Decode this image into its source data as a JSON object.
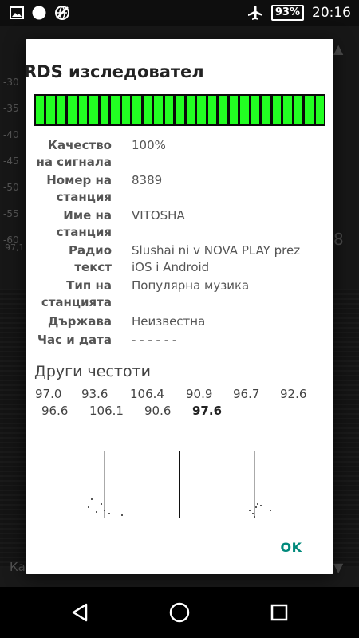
{
  "status_bar": {
    "icons_left": [
      "image-icon",
      "circle-icon",
      "no-network-icon"
    ],
    "icons_right": [
      "airplane-mode-icon"
    ],
    "battery": "93%",
    "time": "20:16"
  },
  "background": {
    "scale": [
      "-30",
      "-35",
      "-40",
      "-45",
      "-50",
      "-55",
      "-60"
    ],
    "freq_label": "97,1",
    "bottom_label": "Ка",
    "right_number": "8"
  },
  "dialog": {
    "title": "RDS изследовател",
    "signal_segments": 27,
    "signal_level_percent": 100,
    "signal_color": "#22ff22",
    "fields": [
      {
        "label_lines": [
          "Качество",
          "на сигнала"
        ],
        "value": "100%"
      },
      {
        "label_lines": [
          "Номер на",
          "станция"
        ],
        "value": "8389"
      },
      {
        "label_lines": [
          "Име на",
          "станция"
        ],
        "value": "VITOSHA"
      },
      {
        "label_lines": [
          "Радио",
          "текст"
        ],
        "value": "Slushai ni v NOVA PLAY prez iOS i Android"
      },
      {
        "label_lines": [
          "Тип на",
          "станцията"
        ],
        "value": "Популярна музика"
      },
      {
        "label_lines": [
          "Държава"
        ],
        "value": "Неизвестна"
      },
      {
        "label_lines": [
          "Час и дата"
        ],
        "value": "- - - - - -"
      }
    ],
    "other_frequencies_title": "Други честоти",
    "frequencies_row1": [
      "97.0",
      "93.6",
      "106.4",
      "90.9",
      "96.7",
      "92.6"
    ],
    "frequencies_row2": [
      "96.6",
      "106.1",
      "90.6",
      "97.6"
    ],
    "current_frequency": "97.6",
    "ok_label": "OK",
    "accent_color": "#00897b"
  },
  "nav_bar": {
    "buttons": [
      "back-icon",
      "home-icon",
      "recents-icon"
    ]
  }
}
